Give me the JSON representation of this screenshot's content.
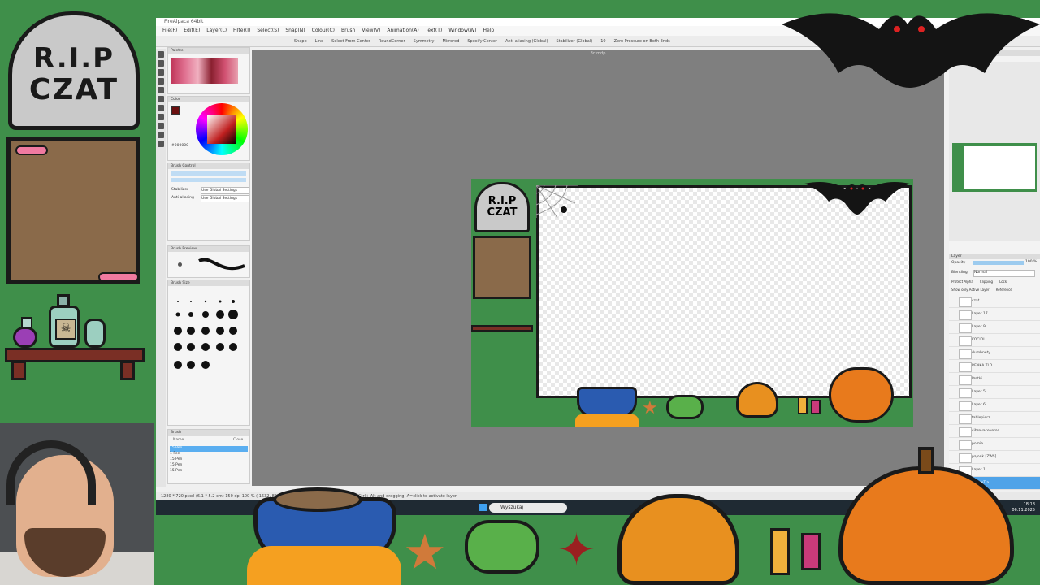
{
  "overlay": {
    "tombstone_line1": "R.I.P",
    "tombstone_line2": "CZAT"
  },
  "app": {
    "title": "FireAlpaca 64bit",
    "menu": [
      "File(F)",
      "Edit(E)",
      "Layer(L)",
      "Filter(I)",
      "Select(S)",
      "Snap(N)",
      "Colour(C)",
      "Brush",
      "View(V)",
      "Animation(A)",
      "Text(T)",
      "Window(W)",
      "Help"
    ],
    "toolbar": {
      "shape_label": "Shape",
      "shape_value": "Line",
      "select_from_center": "Select From Center",
      "round_corner": "RoundCorner",
      "symmetry": "Symmetry",
      "symmetry_value": "Mirrored",
      "specify_center": "Specify Center",
      "antialiasing": "Anti-aliasing (Global)",
      "stabilizer": "Stabilizer (Global)",
      "stabilizer_value": "10",
      "zero_pressure": "Zero Pressure on Both Ends"
    },
    "doc_tab": "8c.mdp",
    "panels": {
      "palette": "Palette",
      "color": "Color",
      "brush_control": "Brush Control",
      "brush_preview": "Brush Preview",
      "brush_size": "Brush Size",
      "brush": "Brush",
      "navigator": "Navigator",
      "layer": "Layer"
    },
    "brush_control": {
      "stabilizer_label": "Stabilizer",
      "stabilizer_value": "Use Global Settings",
      "antialiasing_label": "Anti-aliasing",
      "antialiasing_value": "Use Global Settings"
    },
    "color_value": "#000000",
    "brush_list": {
      "header_name": "Name",
      "header_close": "Close",
      "items": [
        {
          "size": "15",
          "name": "Pen"
        },
        {
          "size": "1",
          "name": "Pen"
        },
        {
          "size": "15",
          "name": "Pen"
        },
        {
          "size": "15",
          "name": "Pen"
        },
        {
          "size": "15",
          "name": "Pen"
        }
      ]
    },
    "layer_panel": {
      "opacity_label": "Opacity",
      "opacity_value": "100 %",
      "blending_label": "Blending",
      "blending_value": "Normal",
      "protect_alpha": "Protect Alpha",
      "clipping": "Clipping",
      "lock": "Lock",
      "show_only_active": "Show only Active Layer",
      "reference": "Reference",
      "layers": [
        "czat",
        "Layer 17",
        "Layer 9",
        "KOCIOL",
        "dumbnety",
        "RENKA TLO",
        "Pretki",
        "Layer 5",
        "Layer 6",
        "tablepierz",
        "cibrevaceverse",
        "pomia",
        "pajonk [ZWS]",
        "Layer 1",
        "purpleTla"
      ],
      "selected_index": 14
    },
    "status": "1280 * 720 pixel  (6.1 * 5.2 cm)  150 dpi  100 %  ( 1632, 858 )   Hold Shift to resize by holding down Ctrl+ Alt and dragging, A=click to activate layer"
  },
  "taskbar": {
    "search_placeholder": "Wyszukaj",
    "time": "18:18",
    "date": "06.11.2025"
  }
}
